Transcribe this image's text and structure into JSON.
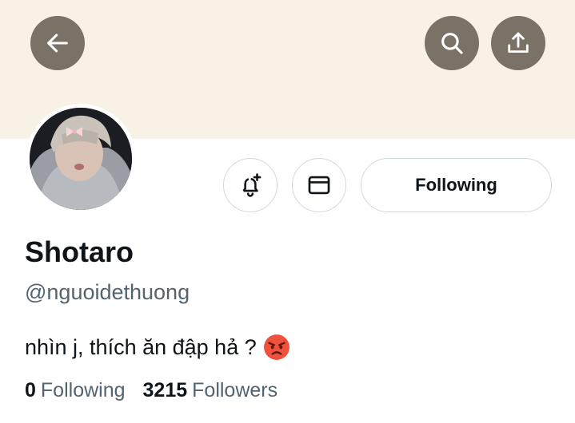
{
  "header": {
    "back_icon": "arrow-left-icon",
    "search_icon": "search-icon",
    "share_icon": "share-upload-icon",
    "banner_color": "#f8f1e6",
    "button_color": "#7a7266"
  },
  "profile": {
    "name": "Shotaro",
    "handle": "@nguoidethuong",
    "bio": "nhìn j, thích ăn đập hả ?",
    "bio_emoji": "angry-face-icon"
  },
  "actions": {
    "notify_icon": "bell-plus-icon",
    "message_icon": "envelope-icon",
    "following_label": "Following"
  },
  "stats": {
    "following_count": "0",
    "following_label": "Following",
    "followers_count": "3215",
    "followers_label": "Followers"
  }
}
